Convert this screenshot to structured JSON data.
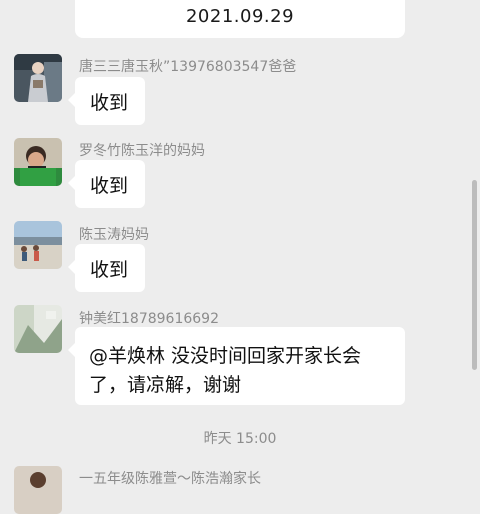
{
  "header_card": {
    "date": "2021.09.29"
  },
  "messages": [
    {
      "sender": "唐三三唐玉秋”13976803547爸爸",
      "text": "收到",
      "avatar": "person-photo-avatar"
    },
    {
      "sender": "罗冬竹陈玉洋的妈妈",
      "text": "收到",
      "avatar": "child-photo-avatar"
    },
    {
      "sender": "陈玉涛妈妈",
      "text": "收到",
      "avatar": "beach-photo-avatar"
    },
    {
      "sender": "钟美红18789616692",
      "text_line1": "@羊焕林  没没时间回家开家长会",
      "text_line2": "了，请凉解，谢谢",
      "avatar": "landscape-photo-avatar"
    }
  ],
  "time_separator": "昨天 15:00",
  "last_sender": "一五年级陈雅萱～陈浩瀚家长"
}
